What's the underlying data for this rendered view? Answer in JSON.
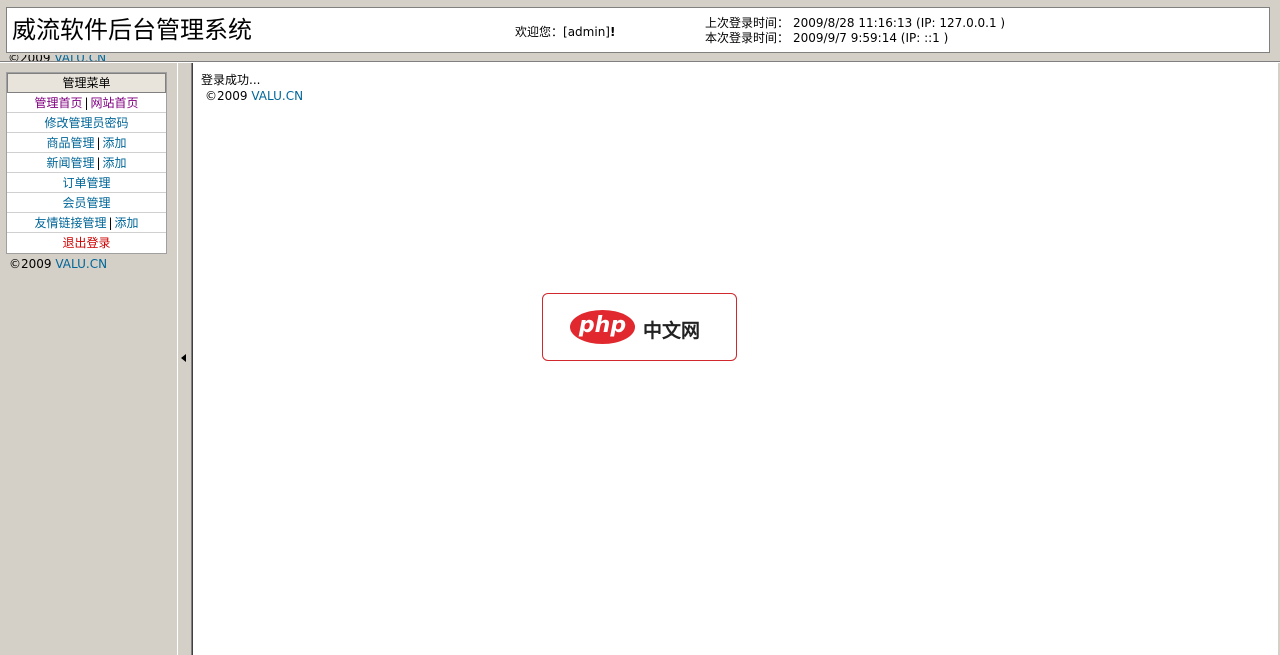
{
  "header": {
    "title": "威流软件后台管理系统",
    "welcome_prefix": "欢迎您：",
    "username": "[admin]",
    "welcome_suffix": "!",
    "last_login_label": "上次登录时间：",
    "last_login_value": "2009/8/28 11:16:13 (IP:  127.0.0.1 )",
    "current_login_label": "本次登录时间：",
    "current_login_value": "2009/9/7 9:59:14 (IP:  ::1 )"
  },
  "copyright": {
    "symbol_year": "©2009 ",
    "brand": "VALU.CN"
  },
  "sidebar": {
    "menu_title": "管理菜单",
    "separator": "|",
    "items": [
      {
        "main": "管理首页",
        "extra": "网站首页"
      },
      {
        "main": "修改管理员密码"
      },
      {
        "main": "商品管理",
        "extra": "添加"
      },
      {
        "main": "新闻管理",
        "extra": "添加"
      },
      {
        "main": "订单管理"
      },
      {
        "main": "会员管理"
      },
      {
        "main": "友情链接管理",
        "extra": "添加"
      },
      {
        "main": "退出登录"
      }
    ]
  },
  "main": {
    "message": "登录成功..."
  },
  "badge": {
    "php": "php",
    "cn": "中文网"
  },
  "colors": {
    "link": "#006699",
    "visited_link": "#800080",
    "logout": "#cc0000",
    "badge_red": "#e0282e"
  }
}
